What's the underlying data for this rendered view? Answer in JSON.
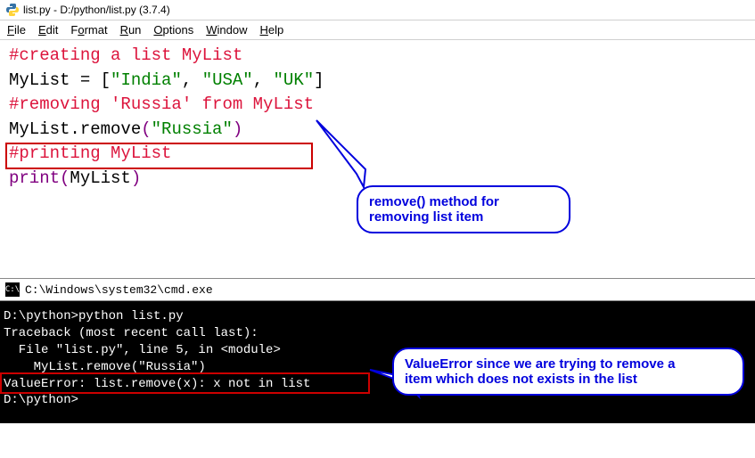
{
  "idle": {
    "title": "list.py - D:/python/list.py (3.7.4)",
    "menu": {
      "file": "File",
      "edit": "Edit",
      "format": "Format",
      "run": "Run",
      "options": "Options",
      "window": "Window",
      "help": "Help"
    },
    "code": {
      "l1_comment": "#creating a list MyList",
      "l2_id": "MyList",
      "l2_eq": " = ",
      "l2_lb": "[",
      "l2_s1": "\"India\"",
      "l2_c1": ", ",
      "l2_s2": "\"USA\"",
      "l2_c2": ", ",
      "l2_s3": "\"UK\"",
      "l2_rb": "]",
      "l3_blank": "",
      "l4_comment": "#removing 'Russia' from MyList",
      "l5_id": "MyList.remove",
      "l5_lp": "(",
      "l5_s": "\"Russia\"",
      "l5_rp": ")",
      "l6_blank": "",
      "l7_comment": "#printing MyList",
      "l8_print": "print",
      "l8_lp": "(",
      "l8_arg": "MyList",
      "l8_rp": ")"
    }
  },
  "callout1": {
    "line1": "remove() method for",
    "line2": "removing list item"
  },
  "cmd": {
    "title": "C:\\Windows\\system32\\cmd.exe",
    "lines": {
      "l1": "D:\\python>python list.py",
      "l2": "Traceback (most recent call last):",
      "l3": "  File \"list.py\", line 5, in <module>",
      "l4": "    MyList.remove(\"Russia\")",
      "l5": "ValueError: list.remove(x): x not in list",
      "l6": "",
      "l7": "D:\\python>"
    }
  },
  "callout2": {
    "line1": "ValueError since we are trying to remove a",
    "line2": "item which does not exists in the list"
  }
}
